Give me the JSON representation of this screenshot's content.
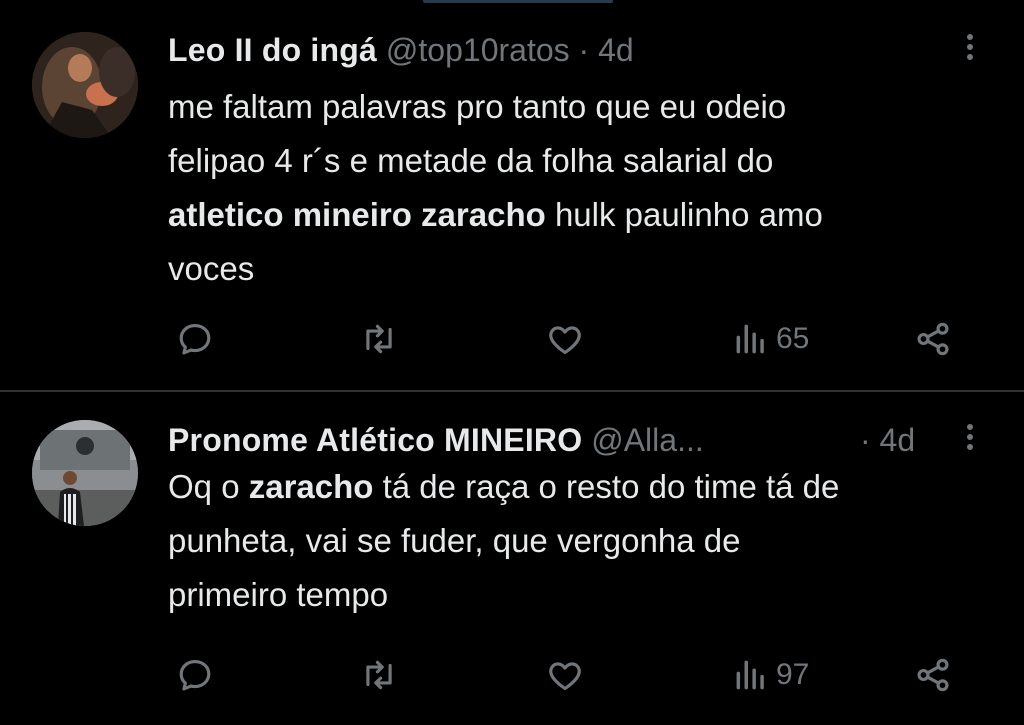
{
  "tweets": [
    {
      "author": "Leo II do ingá",
      "handle": "@top10ratos",
      "separator": "·",
      "time": "4d",
      "body": {
        "line1": "me faltam palavras pro tanto que eu odeio",
        "line2": "felipao 4 r´s e metade da folha salarial do",
        "line3_bold": "atletico mineiro zaracho",
        "line3_rest": " hulk paulinho amo",
        "line4": "voces"
      },
      "views": "65"
    },
    {
      "author": "Pronome Atlético MINEIRO",
      "handle": "@Alla...",
      "separator": "·",
      "time": "4d",
      "body": {
        "line1_pre": "Oq o ",
        "line1_bold": "zaracho",
        "line1_rest": " tá de raça o resto do time tá de",
        "line2": "punheta, vai se fuder, que vergonha de",
        "line3": "primeiro tempo"
      },
      "views": "97"
    }
  ],
  "icons": {
    "reply": "reply-icon",
    "retweet": "retweet-icon",
    "like": "like-icon",
    "views": "views-icon",
    "share": "share-icon",
    "more": "more-options-icon"
  },
  "colors": {
    "background": "#000000",
    "text": "#e7e9ea",
    "secondary": "#71767b",
    "divider": "#2f3336"
  }
}
